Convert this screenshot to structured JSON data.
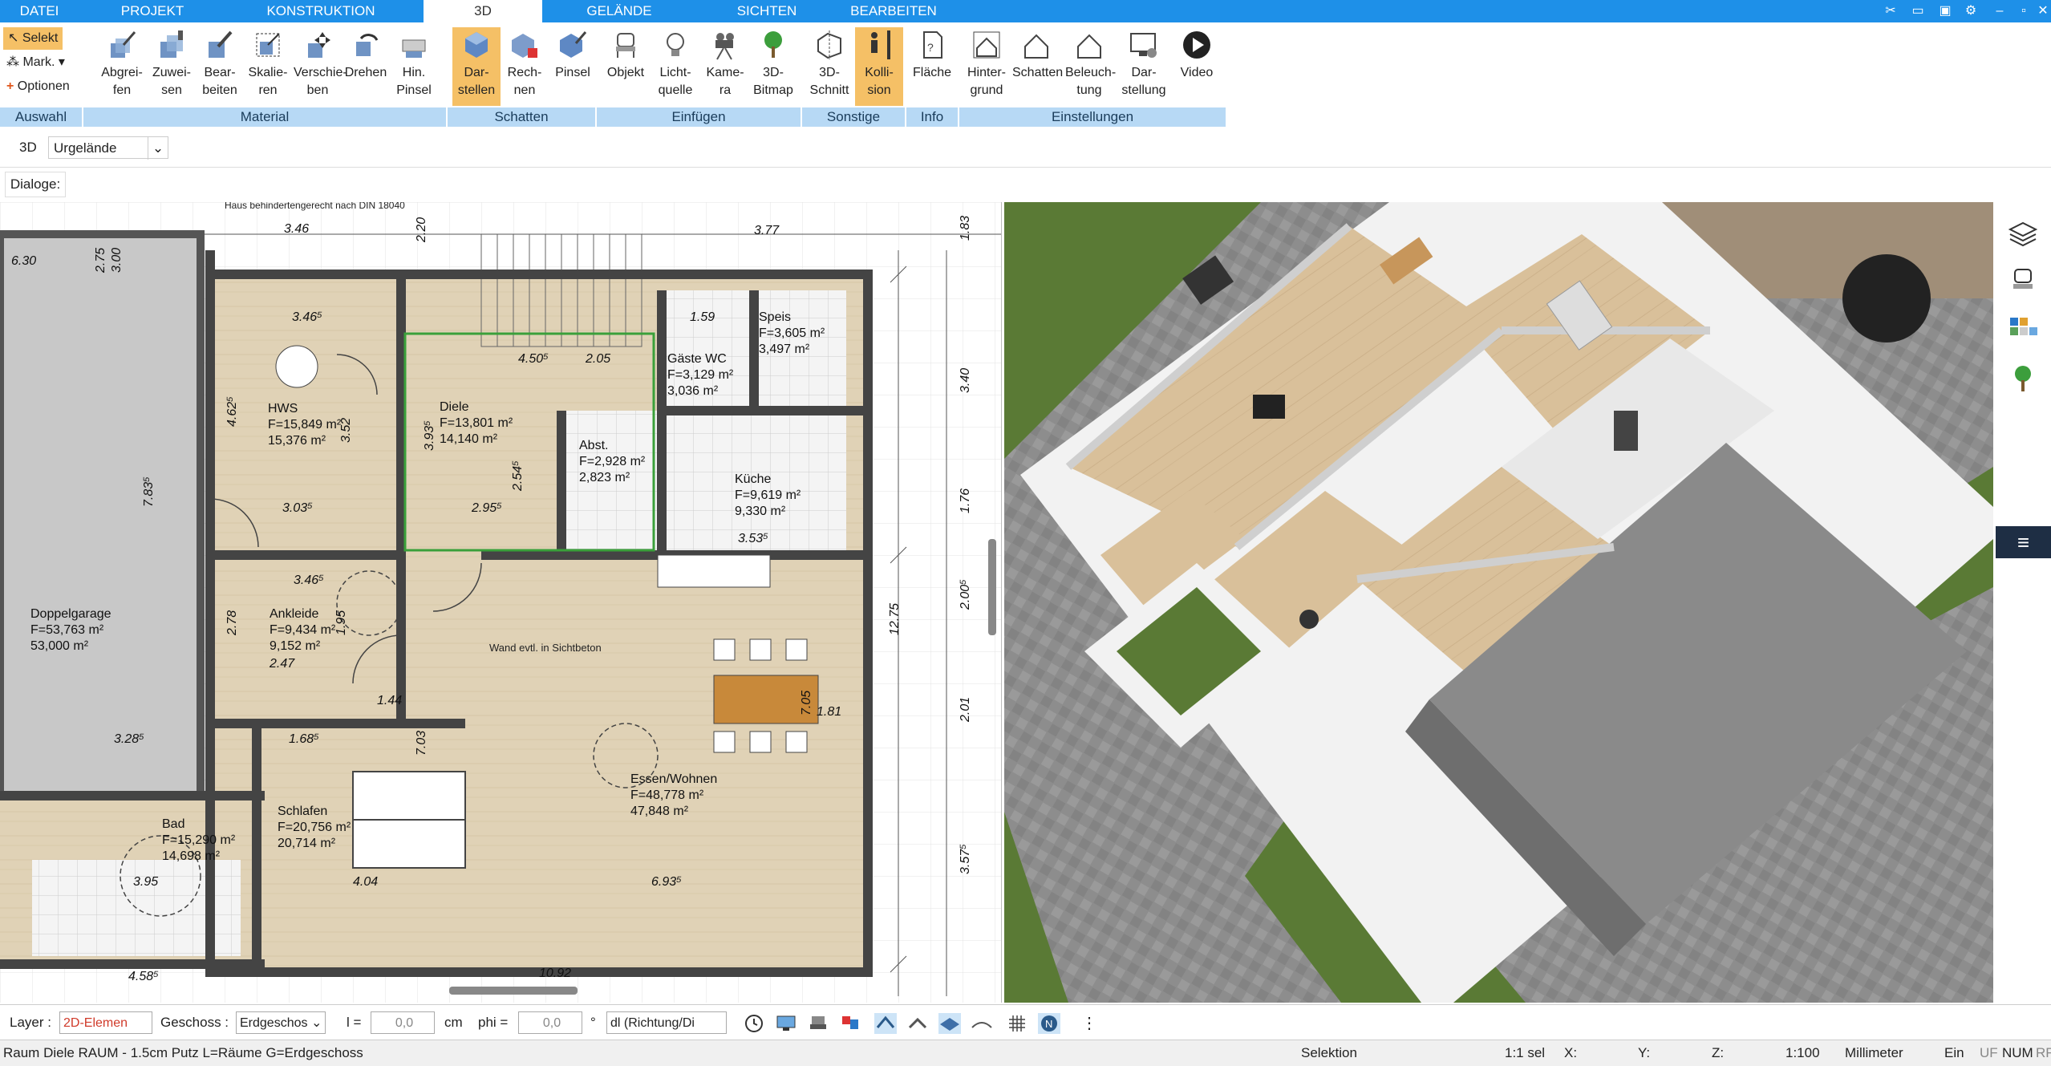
{
  "menu": {
    "tabs": [
      "DATEI",
      "PROJEKT",
      "KONSTRUKTION",
      "3D",
      "GELÄNDE",
      "SICHTEN",
      "BEARBEITEN"
    ],
    "active": "3D"
  },
  "ribbon": {
    "auswahl": {
      "label": "Auswahl",
      "selekt": "Selekt",
      "mark": "Mark.",
      "optionen": "Optionen"
    },
    "material": {
      "label": "Material",
      "buttons": [
        "Abgrei-\nfen",
        "Zuwei-\nsen",
        "Bear-\nbeiten",
        "Skalie-\nren",
        "Verschie-\nben",
        "Drehen",
        "Hin.\nPinsel"
      ]
    },
    "schatten": {
      "label": "Schatten",
      "buttons": [
        "Dar-\nstellen",
        "Rech-\nnen",
        "Pinsel"
      ]
    },
    "einfuegen": {
      "label": "Einfügen",
      "buttons": [
        "Objekt",
        "Licht-\nquelle",
        "Kame-\nra",
        "3D-\nBitmap"
      ]
    },
    "sonstige": {
      "label": "Sonstige",
      "buttons": [
        "3D-\nSchnitt",
        "Kolli-\nsion"
      ]
    },
    "info": {
      "label": "Info",
      "buttons": [
        "Fläche"
      ]
    },
    "einstellungen": {
      "label": "Einstellungen",
      "buttons": [
        "Hinter-\ngrund",
        "Schatten",
        "Beleuch-\ntung",
        "Dar-\nstellung",
        "Video"
      ]
    }
  },
  "row2": {
    "mode": "3D",
    "select_value": "Urgelände"
  },
  "row3": {
    "label": "Dialoge:"
  },
  "plan": {
    "rooms": [
      {
        "name": "HWS",
        "area1": "F=15,849 m²",
        "area2": "15,376 m²"
      },
      {
        "name": "Diele",
        "area1": "F=13,801 m²",
        "area2": "14,140 m²"
      },
      {
        "name": "Speis",
        "area1": "F=3,605 m²",
        "area2": "3,497 m²"
      },
      {
        "name": "Gäste WC",
        "area1": "F=3,129 m²",
        "area2": "3,036 m²"
      },
      {
        "name": "Abst.",
        "area1": "F=2,928 m²",
        "area2": "2,823 m²"
      },
      {
        "name": "Küche",
        "area1": "F=9,619 m²",
        "area2": "9,330 m²"
      },
      {
        "name": "Ankleide",
        "area1": "F=9,434 m²",
        "area2": "9,152 m²"
      },
      {
        "name": "Doppelgarage",
        "area1": "F=53,763 m²",
        "area2": "53,000 m²"
      },
      {
        "name": "Schlafen",
        "area1": "F=20,756 m²",
        "area2": "20,714 m²"
      },
      {
        "name": "Bad",
        "area1": "F=15,290 m²",
        "area2": "14,698 m²"
      },
      {
        "name": "Essen/Wohnen",
        "area1": "F=48,778 m²",
        "area2": "47,848 m²"
      }
    ],
    "note_top": "Haus behindertengerecht nach DIN 18040",
    "note_wall": "Wand evtl. in Sichtbeton",
    "dims": [
      "3.46",
      "6.30",
      "2.75",
      "3.00",
      "2.20",
      "3.77",
      "1.83",
      "3.40",
      "3.46⁵",
      "4.50⁵",
      "2.05",
      "1.59",
      "4.62⁵",
      "3.52",
      "3.03⁵",
      "2.95⁵",
      "3.53⁵",
      "3.46⁵",
      "1.95",
      "2.78",
      "2.47",
      "1.44",
      "7.83⁵",
      "3.28⁵",
      "1.68⁵",
      "7.03",
      "4.04",
      "3.95",
      "6.93⁵",
      "4.58⁵",
      "10.92",
      "12.75",
      "2.01",
      "3.57⁵",
      "1.76",
      "2.00⁵",
      "7.05",
      "1.81",
      "2.54⁵",
      "3.93⁵"
    ]
  },
  "bottom": {
    "layer_label": "Layer :",
    "layer_value": "2D-Elemen",
    "geschoss_label": "Geschoss :",
    "geschoss_value": "Erdgeschos",
    "l_label": "l =",
    "l_value": "0,0",
    "l_unit": "cm",
    "phi_label": "phi =",
    "phi_value": "0,0",
    "phi_unit": "°",
    "dl_value": "dl (Richtung/Di"
  },
  "status": {
    "left": "Raum Diele RAUM - 1.5cm Putz L=Räume G=Erdgeschoss",
    "mode": "Selektion",
    "sel": "1:1 sel",
    "x": "X:",
    "y": "Y:",
    "z": "Z:",
    "scale": "1:100",
    "unit": "Millimeter",
    "ein": "Ein",
    "flags": [
      "UF",
      "NUM",
      "RF"
    ]
  }
}
